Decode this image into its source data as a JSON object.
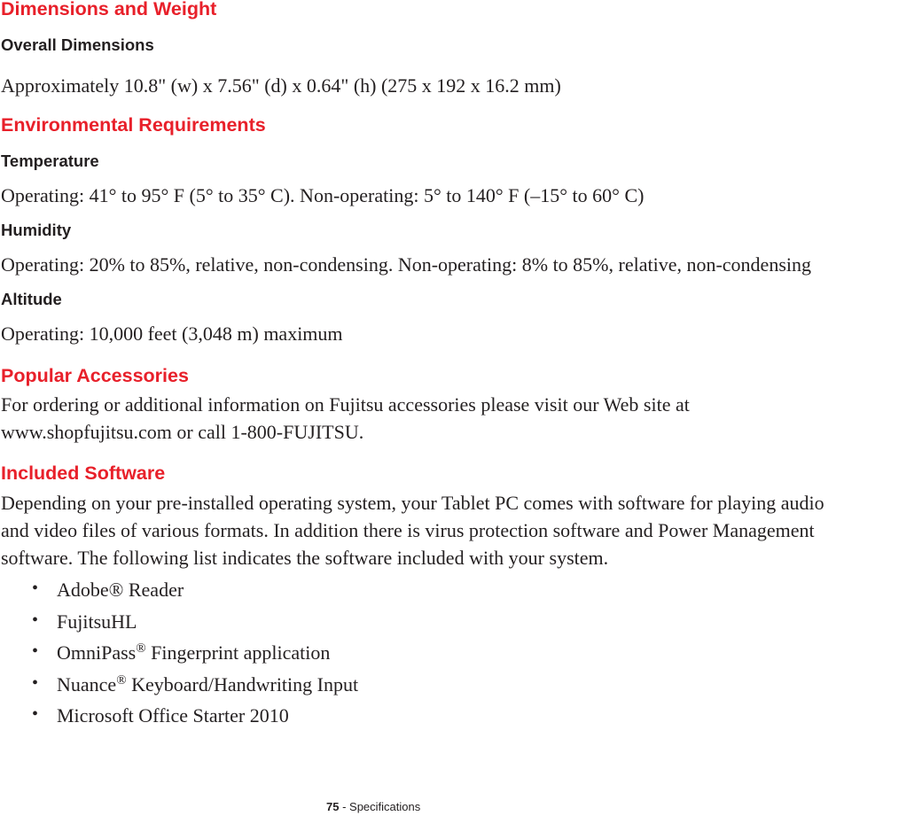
{
  "sections": {
    "dimensions": {
      "heading": "Dimensions and Weight",
      "subheading": "Overall Dimensions",
      "text": "Approximately 10.8\" (w) x 7.56\" (d) x 0.64\" (h) (275 x 192 x 16.2 mm)"
    },
    "environment": {
      "heading": "Environmental Requirements",
      "temperature": {
        "label": "Temperature",
        "text": "Operating: 41° to 95° F (5° to 35° C). Non-operating: 5° to 140° F (–15° to 60° C)"
      },
      "humidity": {
        "label": "Humidity",
        "text": "Operating: 20% to 85%, relative, non-condensing. Non-operating: 8% to 85%, relative, non-condensing"
      },
      "altitude": {
        "label": "Altitude",
        "text": "Operating: 10,000 feet (3,048 m) maximum"
      }
    },
    "accessories": {
      "heading": "Popular Accessories",
      "line1": "For ordering or additional information on Fujitsu accessories please visit our Web site at",
      "line2": "www.shopfujitsu.com or call 1-800-FUJITSU."
    },
    "software": {
      "heading": "Included Software",
      "line1": "Depending on your pre-installed operating system, your Tablet PC comes with software for playing audio",
      "line2": "and video files of various formats. In addition there is virus protection software and Power Management",
      "line3": "software. The following list indicates the software included with your system.",
      "bullet_glyph": "•",
      "items": [
        {
          "name": "Adobe® Reader",
          "sup": "",
          "rest": ""
        },
        {
          "name": "FujitsuHL",
          "sup": "",
          "rest": ""
        },
        {
          "name": "OmniPass",
          "sup": "®",
          "rest": " Fingerprint application"
        },
        {
          "name": "Nuance",
          "sup": "®",
          "rest": " Keyboard/Handwriting Input"
        },
        {
          "name": "Microsoft Office Starter 2010",
          "sup": "",
          "rest": ""
        }
      ]
    }
  },
  "footer": {
    "page_number": "75",
    "separator": " - ",
    "section": "Specifications"
  },
  "colors": {
    "heading": "#e8202a",
    "text": "#231f20"
  }
}
